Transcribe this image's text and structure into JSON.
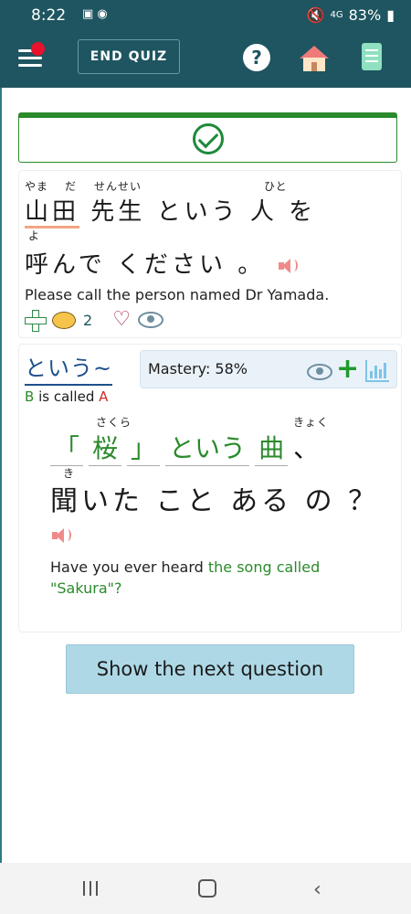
{
  "status_bar": {
    "time": "8:22",
    "battery": "83%",
    "signal_text": "4G"
  },
  "app_bar": {
    "end_quiz_label": "END QUIZ",
    "help_symbol": "?"
  },
  "card1": {
    "line1_furigana": [
      "やま",
      "だ",
      "せんせい",
      "ひと"
    ],
    "line1_words": [
      "山田",
      "先生",
      "という",
      "人",
      "を"
    ],
    "line2_furigana": [
      "よ"
    ],
    "line2_words": [
      "呼んで",
      "ください",
      "。"
    ],
    "english": "Please call the person named Dr Yamada.",
    "comment_count": "2"
  },
  "card2": {
    "grammar_title": "という~",
    "pattern": {
      "b": "B",
      "middle": " is called ",
      "a": "A"
    },
    "mastery_text": "Mastery: 58%",
    "line1_furigana": [
      "さくら",
      "きょく"
    ],
    "line1_tokens": [
      "「",
      "桜",
      "」",
      "という",
      "曲",
      "、"
    ],
    "line2_furigana": [
      "き"
    ],
    "line2_text": "聞いた こと ある の ？",
    "english_plain": "Have you ever heard ",
    "english_green": "the song called \"Sakura\"?"
  },
  "next_button_label": "Show the next question",
  "icons": [
    "hamburger-menu-icon",
    "notification-dot-icon",
    "help-icon",
    "home-icon",
    "book-icon",
    "check-circle-icon",
    "speaker-icon",
    "plus-icon",
    "comment-icon",
    "heart-icon",
    "eye-icon",
    "chart-icon"
  ]
}
